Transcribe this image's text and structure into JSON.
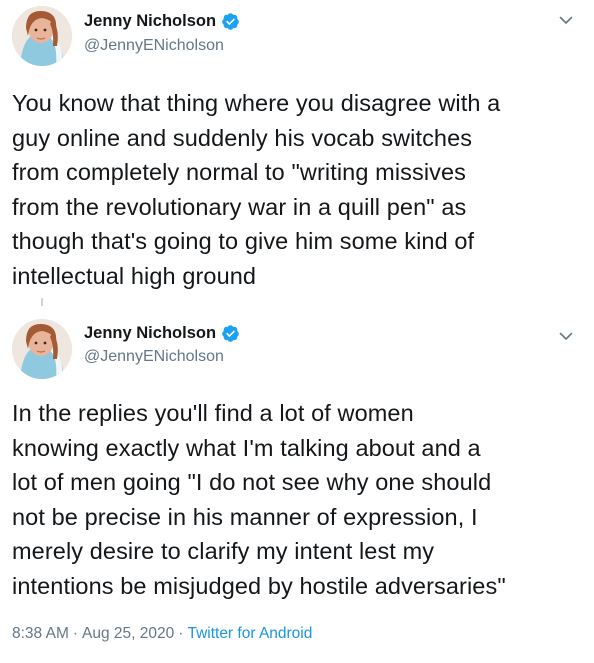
{
  "tweets": [
    {
      "author": {
        "name": "Jenny Nicholson",
        "handle": "@JennyENicholson",
        "verified": true
      },
      "text": "You know that thing where you disagree with a\nguy online and suddenly his vocab switches\nfrom completely normal to \"writing missives\nfrom the revolutionary war in a quill pen\" as\nthough that's going to give him some kind of\nintellectual high ground"
    },
    {
      "author": {
        "name": "Jenny Nicholson",
        "handle": "@JennyENicholson",
        "verified": true
      },
      "text": "In the replies you'll find a lot of women\nknowing exactly what I'm talking about and a\nlot of men going \"I do not see why one should\nnot be precise in his manner of expression, I\nmerely desire to clarify my intent lest my\nintentions be misjudged by hostile adversaries\"",
      "meta": {
        "time": "8:38 AM",
        "date": "Aug 25, 2020",
        "separator": "·",
        "source": "Twitter for Android"
      }
    }
  ],
  "icons": {
    "verified": "verified-badge-icon",
    "caret": "chevron-down-icon"
  },
  "colors": {
    "verified_blue": "#1da1f2",
    "link_blue": "#1b95e0",
    "secondary_text": "#657786",
    "primary_text": "#14171a"
  }
}
